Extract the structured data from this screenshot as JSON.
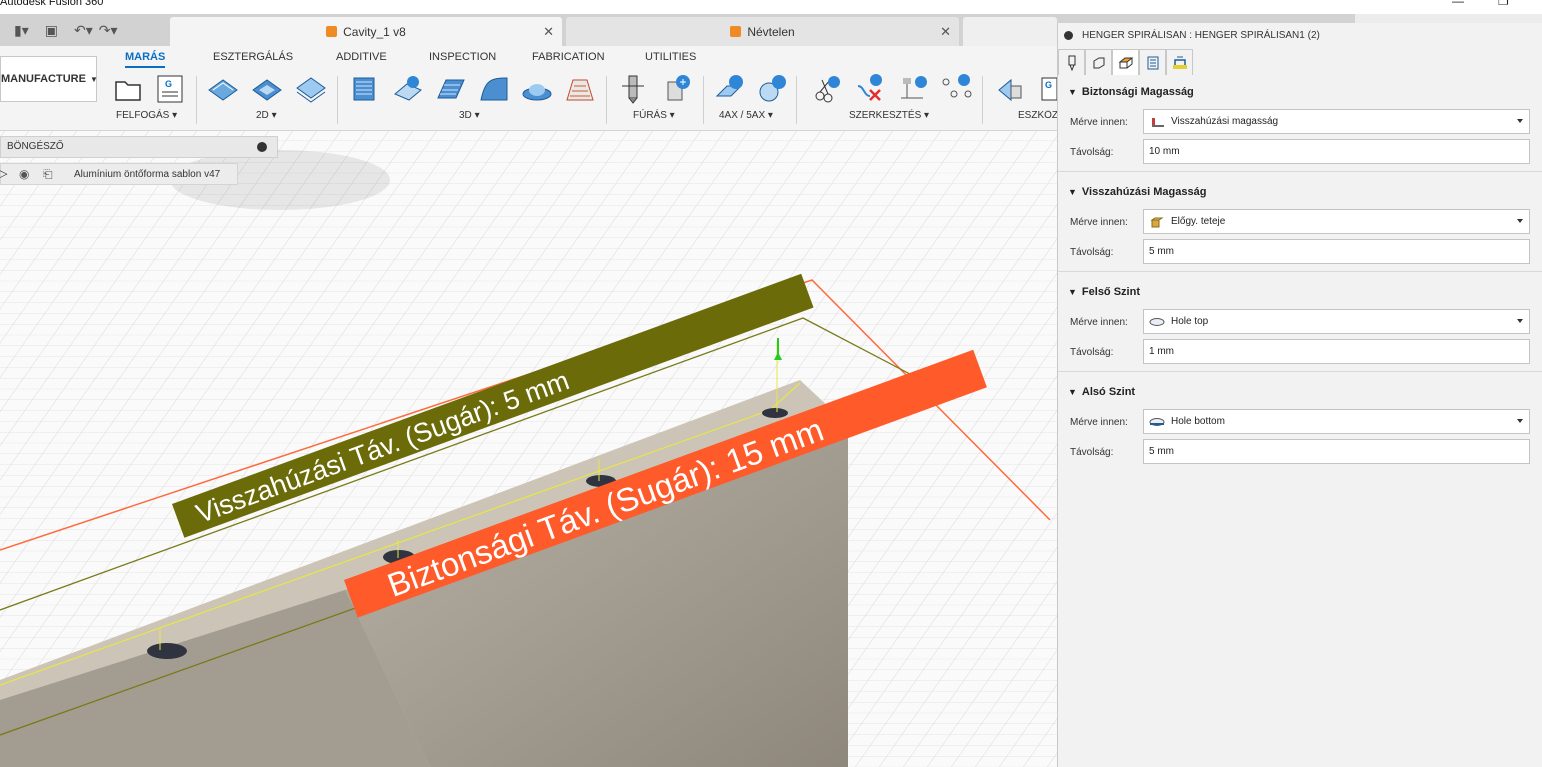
{
  "window": {
    "title": "Autodesk Fusion 360"
  },
  "doc_tabs": [
    {
      "label": "Cavity_1 v8"
    },
    {
      "label": "Névtelen"
    }
  ],
  "ribbon": {
    "workspace": "MANUFACTURE",
    "tabs": [
      "MARÁS",
      "ESZTERGÁLÁS",
      "ADDITIVE",
      "INSPECTION",
      "FABRICATION",
      "UTILITIES"
    ],
    "groups": [
      "FELFOGÁS",
      "2D",
      "3D",
      "FÚRÁS",
      "4AX / 5AX",
      "SZERKESZTÉS",
      "ESZKÖZ"
    ]
  },
  "browser": {
    "title": "BÖNGÉSZŐ",
    "item": "Alumínium öntőforma sablon v47"
  },
  "viewport": {
    "retract_label": "Visszahúzási Táv. (Sugár): 5 mm",
    "safety_label": "Biztonsági Táv. (Sugár): 15 mm",
    "retract_color": "#6b6b0a",
    "safety_color": "#ff5a2a"
  },
  "panel": {
    "title": "HENGER SPIRÁLISAN : HENGER SPIRÁLISAN1 (2)",
    "sections": [
      {
        "title": "Biztonsági Magasság",
        "from_label": "Mérve innen:",
        "from_value": "Visszahúzási magasság",
        "dist_label": "Távolság:",
        "dist_value": "10 mm"
      },
      {
        "title": "Visszahúzási Magasság",
        "from_label": "Mérve innen:",
        "from_value": "Előgy. teteje",
        "dist_label": "Távolság:",
        "dist_value": "5 mm"
      },
      {
        "title": "Felső Szint",
        "from_label": "Mérve innen:",
        "from_value": "Hole top",
        "dist_label": "Távolság:",
        "dist_value": "1 mm"
      },
      {
        "title": "Alsó Szint",
        "from_label": "Mérve innen:",
        "from_value": "Hole bottom",
        "dist_label": "Távolság:",
        "dist_value": "5 mm"
      }
    ]
  }
}
